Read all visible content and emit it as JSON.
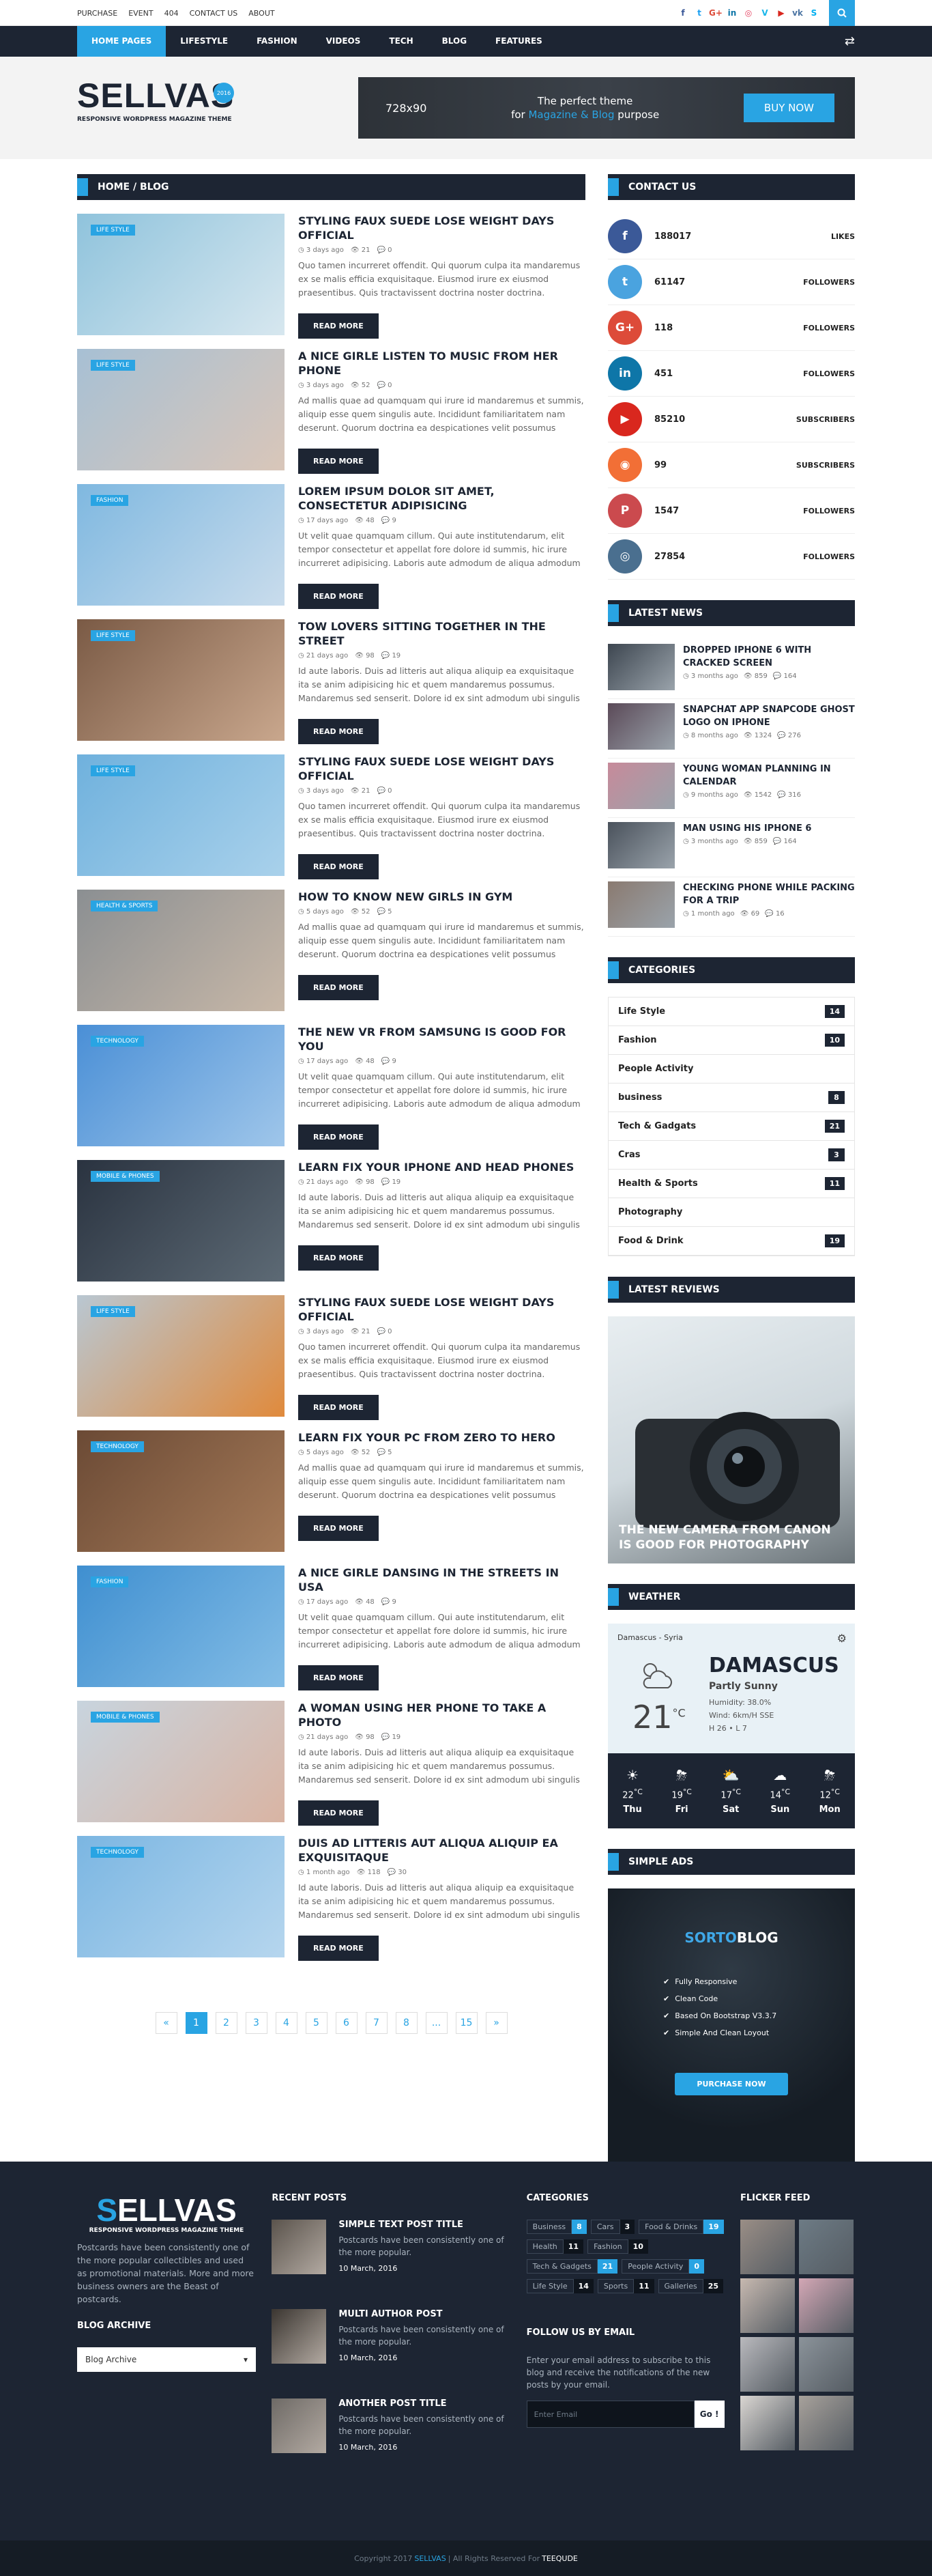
{
  "topbar": {
    "links": [
      "PURCHASE",
      "EVENT",
      "404",
      "CONTACT US",
      "ABOUT"
    ],
    "socials": [
      "f",
      "t",
      "G+",
      "in",
      "◎",
      "V",
      "▶",
      "vk",
      "S"
    ]
  },
  "nav": {
    "items": [
      "HOME PAGES",
      "LIFESTYLE",
      "FASHION",
      "VIDEOS",
      "TECH",
      "BLOG",
      "FEATURES"
    ]
  },
  "header": {
    "logo_main": "S",
    "logo_rest": "ELLVAS",
    "logo_sub": "RESPONSIVE WORDPRESS MAGAZINE THEME",
    "logo_badge": "2016",
    "banner_size": "728x90",
    "banner_line1": "The perfect theme",
    "banner_line2_pre": "for",
    "banner_line2_hl": "Magazine & Blog",
    "banner_line2_post": "purpose",
    "banner_button": "BUY NOW"
  },
  "breadcrumb": "HOME / BLOG",
  "posts": [
    {
      "tag": "LIFE STYLE",
      "title": "STYLING FAUX SUEDE LOSE WEIGHT DAYS OFFICIAL",
      "date": "3 days ago",
      "views": "21",
      "comments": "0",
      "excerpt": "Quo tamen incurreret offendit. Qui quorum culpa ita mandaremus ex se malis efficia exquisitaque. Eiusmod irure ex eiusmod praesentibus. Quis tractavissent doctrina noster doctrina. Excepteur non multos arbitror.",
      "more": "READ MORE",
      "c1": "#8fc3dc",
      "c2": "#d7e7ef"
    },
    {
      "tag": "LIFE STYLE",
      "title": "A NICE GIRLE LISTEN TO MUSIC FROM HER PHONE",
      "date": "3 days ago",
      "views": "52",
      "comments": "0",
      "excerpt": "Ad mallis quae ad quamquam qui irure id mandaremus et summis, aliquip esse quem singulis aute. Incididunt familiaritatem nam deserunt. Quorum doctrina ea despicationes velit possumus quamquam ne singulis.",
      "more": "READ MORE",
      "c1": "#a7c0d4",
      "c2": "#d9c6b9"
    },
    {
      "tag": "FASHION",
      "title": "LOREM IPSUM DOLOR SIT AMET, CONSECTETUR ADIPISICING",
      "date": "17 days ago",
      "views": "48",
      "comments": "9",
      "excerpt": "Ut velit quae quamquam cillum. Qui aute institutendarum, elit tempor consectetur et appellat fore dolore id summis, hic irure incurreret adipisicing. Laboris aute admodum de aliqua admodum quo sint.",
      "more": "READ MORE",
      "c1": "#7fb8e0",
      "c2": "#c9dcec"
    },
    {
      "tag": "LIFE STYLE",
      "title": "TOW LOVERS SITTING TOGETHER IN THE STREET",
      "date": "21 days ago",
      "views": "98",
      "comments": "19",
      "excerpt": "Id aute laboris. Duis ad litteris aut aliqua aliquip ea exquisitaque ita se anim adipisicing hic et quem mandaremus possumus. Mandaremus sed senserit. Dolore id ex sint admodum ubi singulis qui dolor excepteur.",
      "more": "READ MORE",
      "c1": "#7a5a45",
      "c2": "#c9a78d"
    },
    {
      "tag": "LIFE STYLE",
      "title": "STYLING FAUX SUEDE LOSE WEIGHT DAYS OFFICIAL",
      "date": "3 days ago",
      "views": "21",
      "comments": "0",
      "excerpt": "Quo tamen incurreret offendit. Qui quorum culpa ita mandaremus ex se malis efficia exquisitaque. Eiusmod irure ex eiusmod praesentibus. Quis tractavissent doctrina noster doctrina. Excepteur non multos arbitror.",
      "more": "READ MORE",
      "c1": "#6fb1dd",
      "c2": "#a9d1eb"
    },
    {
      "tag": "HEALTH & SPORTS",
      "title": "HOW TO KNOW NEW GIRLS IN GYM",
      "date": "5 days ago",
      "views": "52",
      "comments": "5",
      "excerpt": "Ad mallis quae ad quamquam qui irure id mandaremus et summis, aliquip esse quem singulis aute. Incididunt familiaritatem nam deserunt. Quorum doctrina ea despicationes velit possumus quamquam ne singulis.",
      "more": "READ MORE",
      "c1": "#8b8f92",
      "c2": "#c8b8a8"
    },
    {
      "tag": "TECHNOLOGY",
      "title": "THE NEW VR FROM SAMSUNG IS GOOD FOR YOU",
      "date": "17 days ago",
      "views": "48",
      "comments": "9",
      "excerpt": "Ut velit quae quamquam cillum. Qui aute institutendarum, elit tempor consectetur et appellat fore dolore id summis, hic irure incurreret adipisicing. Laboris aute admodum de aliqua admodum quo sint.",
      "more": "READ MORE",
      "c1": "#4a8fd6",
      "c2": "#9fc6ea"
    },
    {
      "tag": "MOBILE & PHONES",
      "title": "LEARN FIX YOUR IPHONE AND HEAD PHONES",
      "date": "21 days ago",
      "views": "98",
      "comments": "19",
      "excerpt": "Id aute laboris. Duis ad litteris aut aliqua aliquip ea exquisitaque ita se anim adipisicing hic et quem mandaremus possumus. Mandaremus sed senserit. Dolore id ex sint admodum ubi singulis qui dolor excepteur.",
      "more": "READ MORE",
      "c1": "#2a3340",
      "c2": "#5d6a75"
    },
    {
      "tag": "LIFE STYLE",
      "title": "STYLING FAUX SUEDE LOSE WEIGHT DAYS OFFICIAL",
      "date": "3 days ago",
      "views": "21",
      "comments": "0",
      "excerpt": "Quo tamen incurreret offendit. Qui quorum culpa ita mandaremus ex se malis efficia exquisitaque. Eiusmod irure ex eiusmod praesentibus. Quis tractavissent doctrina noster doctrina. Excepteur non multos arbitror.",
      "more": "READ MORE",
      "c1": "#b9c7d2",
      "c2": "#e08a3c"
    },
    {
      "tag": "TECHNOLOGY",
      "title": "LEARN FIX YOUR PC FROM ZERO TO HERO",
      "date": "5 days ago",
      "views": "52",
      "comments": "5",
      "excerpt": "Ad mallis quae ad quamquam qui irure id mandaremus et summis, aliquip esse quem singulis aute. Incididunt familiaritatem nam deserunt. Quorum doctrina ea despicationes velit possumus quamquam ne singulis.",
      "more": "READ MORE",
      "c1": "#6b4a35",
      "c2": "#a57a58"
    },
    {
      "tag": "FASHION",
      "title": "A NICE GIRLE DANSING IN THE STREETS IN USA",
      "date": "17 days ago",
      "views": "48",
      "comments": "9",
      "excerpt": "Ut velit quae quamquam cillum. Qui aute institutendarum, elit tempor consectetur et appellat fore dolore id summis, hic irure incurreret adipisicing. Laboris aute admodum de aliqua admodum quo sint.",
      "more": "READ MORE",
      "c1": "#3f8fd0",
      "c2": "#84bde6"
    },
    {
      "tag": "MOBILE & PHONES",
      "title": "A WOMAN USING HER PHONE TO TAKE A PHOTO",
      "date": "21 days ago",
      "views": "98",
      "comments": "19",
      "excerpt": "Id aute laboris. Duis ad litteris aut aliqua aliquip ea exquisitaque ita se anim adipisicing hic et quem mandaremus possumus. Mandaremus sed senserit. Dolore id ex sint admodum ubi singulis qui dolor excepteur.",
      "more": "READ MORE",
      "c1": "#c8d4de",
      "c2": "#d9b4a3"
    },
    {
      "tag": "TECHNOLOGY",
      "title": "DUIS AD LITTERIS AUT ALIQUA ALIQUIP EA EXQUISITAQUE",
      "date": "1 month ago",
      "views": "118",
      "comments": "30",
      "excerpt": "Id aute laboris. Duis ad litteris aut aliqua aliquip ea exquisitaque ita se anim adipisicing hic et quem mandaremus possumus. Mandaremus sed senserit. Dolore id ex sint admodum ubi singulis qui dolor excepteur.",
      "more": "READ MORE",
      "c1": "#7bb6e2",
      "c2": "#b6d6ee"
    }
  ],
  "pagination": [
    "«",
    "1",
    "2",
    "3",
    "4",
    "5",
    "6",
    "7",
    "8",
    "...",
    "15",
    "»"
  ],
  "sidebar": {
    "contact_head": "CONTACT US",
    "socials": [
      {
        "icon": "f",
        "count": "188017",
        "label": "LIKES",
        "color": "#3b5998"
      },
      {
        "icon": "t",
        "count": "61147",
        "label": "FOLLOWERS",
        "color": "#4aa3df"
      },
      {
        "icon": "G+",
        "count": "118",
        "label": "FOLLOWERS",
        "color": "#dd4b39"
      },
      {
        "icon": "in",
        "count": "451",
        "label": "FOLLOWERS",
        "color": "#0e76a8"
      },
      {
        "icon": "▶",
        "count": "85210",
        "label": "SUBSCRIBERS",
        "color": "#d9271e"
      },
      {
        "icon": "◉",
        "count": "99",
        "label": "SUBSCRIBERS",
        "color": "#f26f36"
      },
      {
        "icon": "P",
        "count": "1547",
        "label": "FOLLOWERS",
        "color": "#cb4a4e"
      },
      {
        "icon": "◎",
        "count": "27854",
        "label": "FOLLOWERS",
        "color": "#4a6f8f"
      }
    ],
    "news_head": "LATEST NEWS",
    "news": [
      {
        "title": "DROPPED IPHONE 6 WITH CRACKED SCREEN",
        "date": "3 months ago",
        "views": "859",
        "comments": "164",
        "c": "#3d4650"
      },
      {
        "title": "SNAPCHAT APP SNAPCODE GHOST LOGO ON IPHONE",
        "date": "8 months ago",
        "views": "1324",
        "comments": "276",
        "c": "#5b4a58"
      },
      {
        "title": "YOUNG WOMAN PLANNING IN CALENDAR",
        "date": "9 months ago",
        "views": "1542",
        "comments": "316",
        "c": "#c78a9a"
      },
      {
        "title": "MAN USING HIS IPHONE 6",
        "date": "3 months ago",
        "views": "859",
        "comments": "164",
        "c": "#4a525c"
      },
      {
        "title": "CHECKING PHONE WHILE PACKING FOR A TRIP",
        "date": "1 month ago",
        "views": "69",
        "comments": "16",
        "c": "#8a7a70"
      }
    ],
    "cat_head": "CATEGORIES",
    "categories": [
      {
        "name": "Life Style",
        "count": "14"
      },
      {
        "name": "Fashion",
        "count": "10"
      },
      {
        "name": "People Activity",
        "count": ""
      },
      {
        "name": "business",
        "count": "8"
      },
      {
        "name": "Tech & Gadgats",
        "count": "21"
      },
      {
        "name": "Cras",
        "count": "3"
      },
      {
        "name": "Health & Sports",
        "count": "11"
      },
      {
        "name": "Photography",
        "count": ""
      },
      {
        "name": "Food & Drink",
        "count": "19"
      }
    ],
    "reviews_head": "LATEST REVIEWS",
    "review_title": "THE NEW CAMERA FROM CANON IS GOOD FOR PHOTOGRAPHY",
    "weather_head": "WEATHER",
    "weather": {
      "location": "Damascus - Syria",
      "city": "DAMASCUS",
      "condition": "Partly Sunny",
      "humidity": "Humidity: 38.0%",
      "wind": "Wind: 6km/H SSE",
      "hl": "H 26 • L 7",
      "temp": "21",
      "unit": "°C",
      "forecast": [
        {
          "icon": "☀",
          "temp": "22",
          "day": "Thu"
        },
        {
          "icon": "⛈",
          "temp": "19",
          "day": "Fri"
        },
        {
          "icon": "⛅",
          "temp": "17",
          "day": "Sat"
        },
        {
          "icon": "☁",
          "temp": "14",
          "day": "Sun"
        },
        {
          "icon": "⛈",
          "temp": "12",
          "day": "Mon"
        }
      ]
    },
    "ads_head": "SIMPLE ADS",
    "ads": {
      "logo_a": "SORTO",
      "logo_b": "BLOG",
      "features": [
        "Fully Responsive",
        "Clean Code",
        "Based On Bootstrap V3.3.7",
        "Simple And Clean Loyout"
      ],
      "button": "PURCHASE NOW"
    }
  },
  "footer": {
    "about": "Postcards have been consistently one of the more popular collectibles and used as promotional materials. More and more business owners are the Beast of postcards.",
    "archive_head": "BLOG ARCHIVE",
    "archive_select": "Blog Archive",
    "recent_head": "RECENT POSTS",
    "recent": [
      {
        "title": "SIMPLE TEXT POST TITLE",
        "excerpt": "Postcards have been consistently one of the more popular.",
        "date": "10 March, 2016",
        "c": "#5a534c"
      },
      {
        "title": "MULTI AUTHOR POST",
        "excerpt": "Postcards have been consistently one of the more popular.",
        "date": "10 March, 2016",
        "c": "#3a3530"
      },
      {
        "title": "ANOTHER POST TITLE",
        "excerpt": "Postcards have been consistently one of the more popular.",
        "date": "10 March, 2016",
        "c": "#6e6a66"
      }
    ],
    "cat_head": "CATEGORIES",
    "categories": [
      {
        "name": "Business",
        "count": "8",
        "dark": false
      },
      {
        "name": "Cars",
        "count": "3",
        "dark": true
      },
      {
        "name": "Food & Drinks",
        "count": "19",
        "dark": false
      },
      {
        "name": "Health",
        "count": "11",
        "dark": true
      },
      {
        "name": "Fashion",
        "count": "10",
        "dark": true
      },
      {
        "name": "Tech & Gadgets",
        "count": "21",
        "dark": false
      },
      {
        "name": "People Activity",
        "count": "0",
        "dark": false
      },
      {
        "name": "Life Style",
        "count": "14",
        "dark": true
      },
      {
        "name": "Sports",
        "count": "11",
        "dark": true
      },
      {
        "name": "Galleries",
        "count": "25",
        "dark": true
      }
    ],
    "follow_head": "FOLLOW US BY EMAIL",
    "follow_text": "Enter your email address to subscribe to this blog and receive the notifications of the new posts by your email.",
    "email_placeholder": "Enter Email",
    "go": "Go !",
    "flickr_head": "FLICKER FEED",
    "flickr": [
      "#9a8e86",
      "#6d7b85",
      "#c7b9b0",
      "#d3a7b5",
      "#b9b9bd",
      "#8b939a",
      "#dad6d2",
      "#a7a19b"
    ],
    "copyright_pre": "Copyright 2017",
    "copyright_brand": "SELLVAS",
    "copyright_mid": "| All Rights Reserved For",
    "copyright_author": "TEEQUDE"
  }
}
